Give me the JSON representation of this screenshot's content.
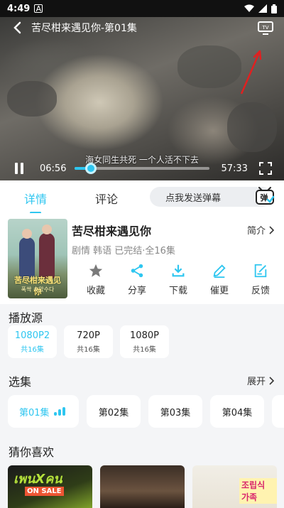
{
  "status": {
    "time": "4:49",
    "a_icon": "A"
  },
  "player": {
    "title": "苦尽柑来遇见你-第01集",
    "subtitle": "海女同生共死 一个人活不下去",
    "current_time": "06:56",
    "total_time": "57:33",
    "progress": 0.12
  },
  "tabs": {
    "details": "详情",
    "comments": "评论",
    "danmaku_placeholder": "点我发送弹幕",
    "danmaku_icon": "弹"
  },
  "drama": {
    "title": "苦尽柑来遇见你",
    "intro_label": "简介",
    "meta": "剧情 韩语 已完结·全16集",
    "poster_text": "苦尽柑来遇见你",
    "poster_subtext": "폭싹 속았수다"
  },
  "actions": [
    {
      "label": "收藏",
      "icon": "star-icon"
    },
    {
      "label": "分享",
      "icon": "share-icon"
    },
    {
      "label": "下载",
      "icon": "download-icon"
    },
    {
      "label": "催更",
      "icon": "pen-icon"
    },
    {
      "label": "反馈",
      "icon": "feedback-icon"
    }
  ],
  "sources": {
    "title": "播放源",
    "items": [
      {
        "name": "1080P2",
        "count": "共16集",
        "active": true
      },
      {
        "name": "720P",
        "count": "共16集",
        "active": false
      },
      {
        "name": "1080P",
        "count": "共16集",
        "active": false
      }
    ]
  },
  "episodes": {
    "title": "选集",
    "expand_label": "展开",
    "items": [
      "第01集",
      "第02集",
      "第03集",
      "第04集"
    ]
  },
  "recommend": {
    "title": "猜你喜欢",
    "items": [
      {
        "title_art": "เพนXคน",
        "badge": "ON SALE"
      },
      {
        "title_art": ""
      },
      {
        "title_art": "조립식 가족"
      }
    ]
  },
  "colors": {
    "accent": "#2ec6f0",
    "annotation_arrow": "#e02020"
  }
}
